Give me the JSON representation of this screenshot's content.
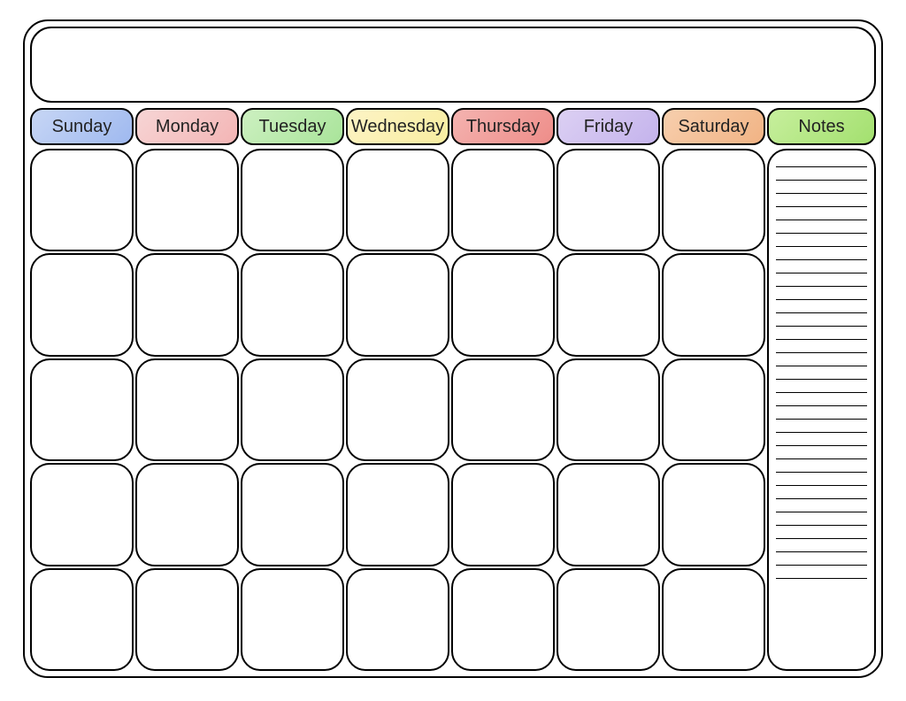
{
  "title": "",
  "days": [
    {
      "label": "Sunday",
      "bg": "linear-gradient(135deg, #c7d6f5 0%, #9fb9ef 100%)"
    },
    {
      "label": "Monday",
      "bg": "linear-gradient(135deg, #f7d5d5 0%, #f3b5b5 100%)"
    },
    {
      "label": "Tuesday",
      "bg": "linear-gradient(135deg, #cdf0c1 0%, #a9e49a 100%)"
    },
    {
      "label": "Wednesday",
      "bg": "linear-gradient(135deg, #fdf4c6 0%, #f8eda0 100%)"
    },
    {
      "label": "Thursday",
      "bg": "linear-gradient(135deg, #f4b3b0 0%, #ee8d89 100%)"
    },
    {
      "label": "Friday",
      "bg": "linear-gradient(135deg, #dcd0f3 0%, #c4b3ec 100%)"
    },
    {
      "label": "Saturday",
      "bg": "linear-gradient(135deg, #f7cfae 0%, #f1b384 100%)"
    }
  ],
  "notes": {
    "label": "Notes",
    "bg": "linear-gradient(135deg, #c7ef9d 0%, #a3e06f 100%)",
    "line_count": 32
  },
  "grid": {
    "rows": 5,
    "cols": 7
  }
}
